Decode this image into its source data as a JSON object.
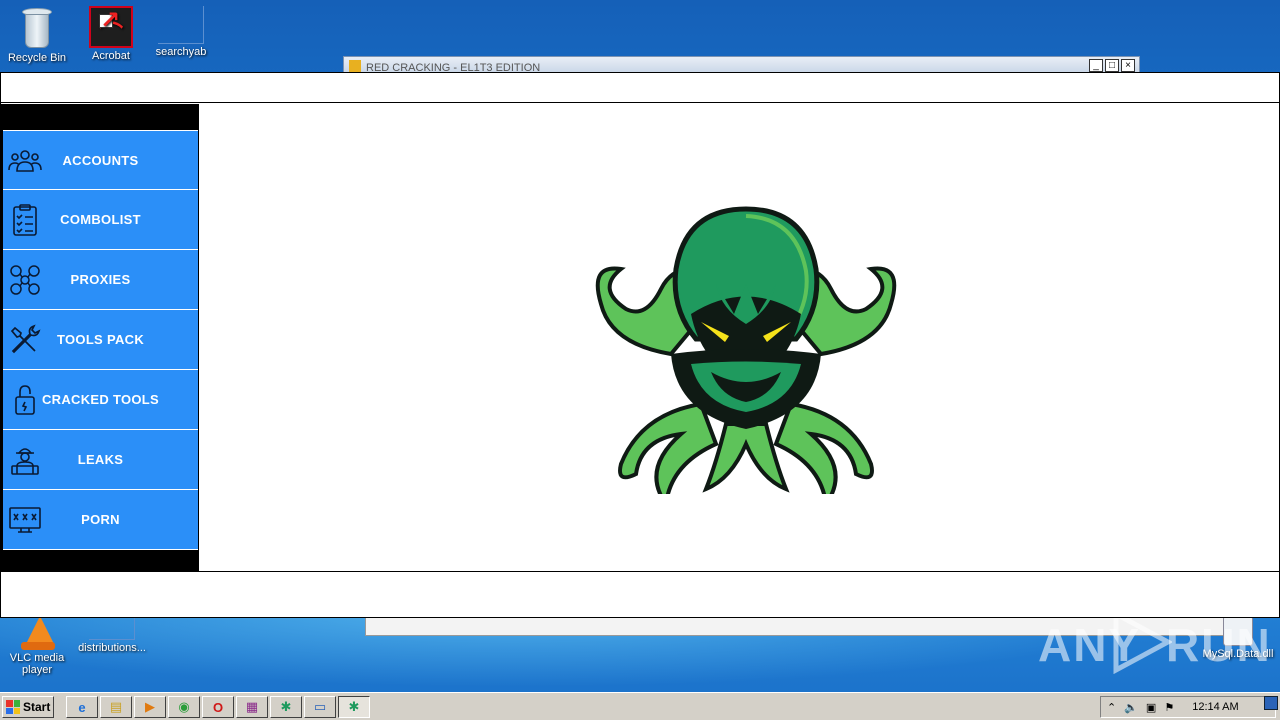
{
  "desktop": {
    "icons_top": [
      {
        "label": "Recycle Bin"
      },
      {
        "label": "Acrobat"
      },
      {
        "label": "searchyab"
      }
    ],
    "icons_bottom": [
      {
        "label": "VLC media player"
      },
      {
        "label": "distributions..."
      },
      {
        "label": "MySql.Data.dll"
      }
    ]
  },
  "background_window": {
    "title": "RED CRACKING - EL1T3 EDITION",
    "buttons": [
      "_",
      "□",
      "×"
    ]
  },
  "app": {
    "menu": [
      {
        "label": "ACCOUNTS",
        "icon": "users-icon"
      },
      {
        "label": "COMBOLIST",
        "icon": "clipboard-checklist-icon"
      },
      {
        "label": "PROXIES",
        "icon": "network-nodes-icon"
      },
      {
        "label": "TOOLS PACK",
        "icon": "wrench-screwdriver-icon"
      },
      {
        "label": "CRACKED TOOLS",
        "icon": "padlock-icon"
      },
      {
        "label": "LEAKS",
        "icon": "hacker-laptop-icon"
      },
      {
        "label": "PORN",
        "icon": "xxx-monitor-icon"
      }
    ],
    "colors": {
      "menu_bg": "#2b8ff8",
      "sidebar_bg": "#000000",
      "logo_green": "#1f9a5e",
      "logo_dark": "#0f1a14",
      "logo_eyes": "#f5e21a"
    }
  },
  "watermark": {
    "left": "ANY",
    "right": "RUN"
  },
  "taskbar": {
    "start_label": "Start",
    "apps": [
      {
        "icon": "ie-icon",
        "glyph": "e"
      },
      {
        "icon": "explorer-icon",
        "glyph": "▤"
      },
      {
        "icon": "media-player-icon",
        "glyph": "▶"
      },
      {
        "icon": "chrome-icon",
        "glyph": "◉"
      },
      {
        "icon": "opera-icon",
        "glyph": "O"
      },
      {
        "icon": "winrar-icon",
        "glyph": "▦"
      },
      {
        "icon": "octopus-app-icon",
        "glyph": "✱"
      },
      {
        "icon": "window-icon",
        "glyph": "▭"
      },
      {
        "icon": "octopus-app-active-icon",
        "glyph": "✱"
      }
    ],
    "clock": "12:14 AM"
  }
}
